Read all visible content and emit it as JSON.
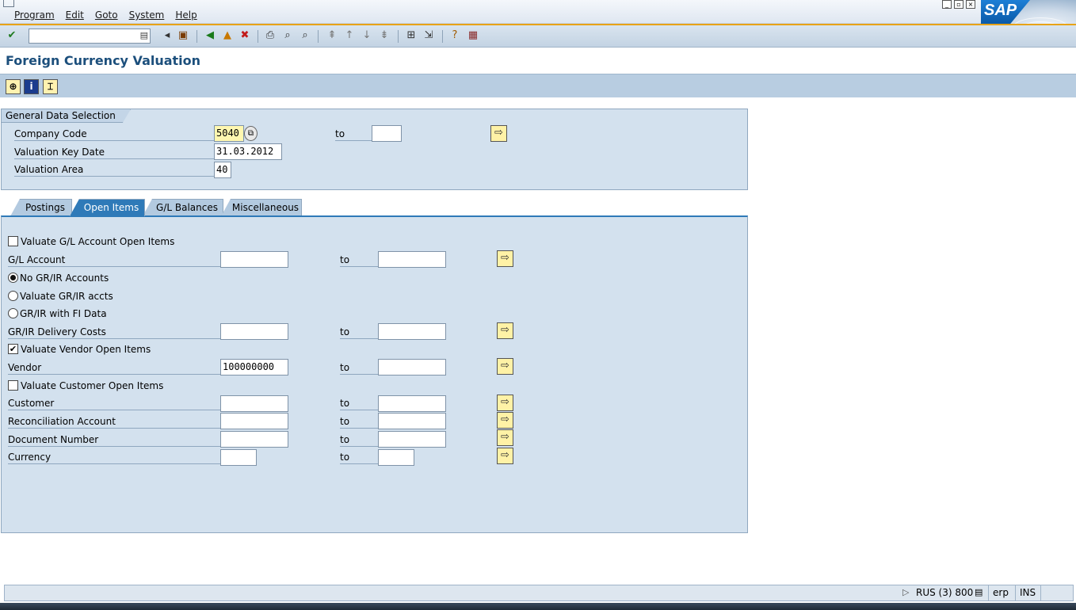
{
  "menu": {
    "items": [
      "Program",
      "Edit",
      "Goto",
      "System",
      "Help"
    ]
  },
  "sap_logo": "SAP",
  "title": "Foreign Currency Valuation",
  "general": {
    "title": "General Data Selection",
    "company_code": {
      "label": "Company Code",
      "value": "5040",
      "to_label": "to",
      "to_value": ""
    },
    "key_date": {
      "label": "Valuation Key Date",
      "value": "31.03.2012"
    },
    "area": {
      "label": "Valuation Area",
      "value": "40"
    }
  },
  "tabs": [
    {
      "label": "Postings",
      "active": false
    },
    {
      "label": "Open Items",
      "active": true
    },
    {
      "label": "G/L Balances",
      "active": false
    },
    {
      "label": "Miscellaneous",
      "active": false
    }
  ],
  "open_items": {
    "valuate_gl": {
      "label": "Valuate G/L Account Open Items",
      "checked": false
    },
    "gl_account": {
      "label": "G/L Account",
      "from": "",
      "to": ""
    },
    "no_grir": {
      "label": "No GR/IR Accounts",
      "selected": true
    },
    "valuate_grir": {
      "label": "Valuate GR/IR accts",
      "selected": false
    },
    "grir_fi": {
      "label": "GR/IR with FI Data",
      "selected": false
    },
    "grir_delivery": {
      "label": "GR/IR Delivery Costs",
      "from": "",
      "to": ""
    },
    "valuate_vendor": {
      "label": "Valuate Vendor Open Items",
      "checked": true
    },
    "vendor": {
      "label": "Vendor",
      "from": "100000000",
      "to": ""
    },
    "valuate_customer": {
      "label": "Valuate Customer Open Items",
      "checked": false
    },
    "customer": {
      "label": "Customer",
      "from": "",
      "to": ""
    },
    "recon": {
      "label": "Reconciliation Account",
      "from": "",
      "to": ""
    },
    "docnum": {
      "label": "Document Number",
      "from": "",
      "to": ""
    },
    "currency": {
      "label": "Currency",
      "from": "",
      "to": ""
    },
    "to_label": "to"
  },
  "status": {
    "system": "RUS (3) 800",
    "server": "erp",
    "mode": "INS"
  }
}
